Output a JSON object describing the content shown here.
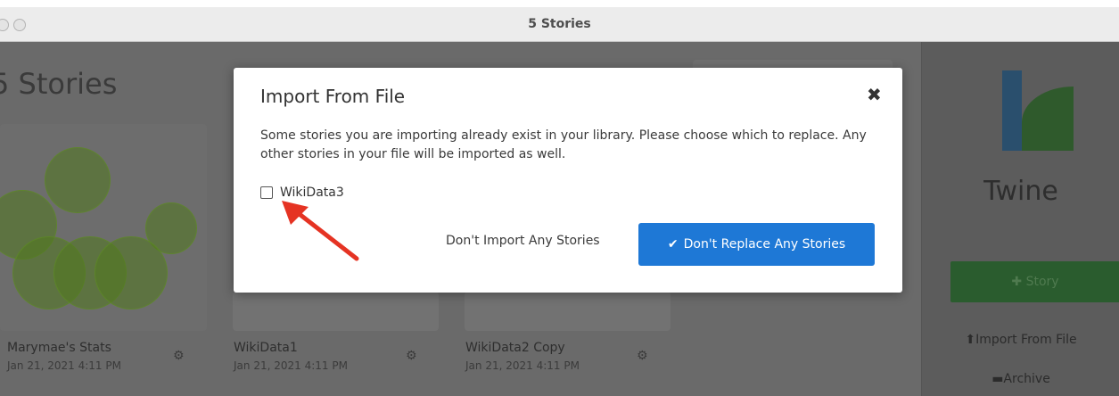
{
  "window": {
    "title": "5 Stories"
  },
  "library": {
    "heading": "5 Stories",
    "cards": [
      {
        "name": "Marymae's Stats",
        "date": "Jan 21, 2021 4:11 PM"
      },
      {
        "name": "WikiData1",
        "date": "Jan 21, 2021 4:11 PM"
      },
      {
        "name": "WikiData2 Copy",
        "date": "Jan 21, 2021 4:11 PM"
      }
    ]
  },
  "sidebar": {
    "logo_text": "Twine",
    "story_button": "Story",
    "import_link": "Import From File",
    "archive_link": "Archive"
  },
  "dialog": {
    "title": "Import From File",
    "close_icon": "close-icon",
    "message": "Some stories you are importing already exist in your library. Please choose which to replace. Any other stories in your file will be imported as well.",
    "story_option": {
      "label": "WikiData3",
      "checked": false
    },
    "secondary_button": "Don't Import Any Stories",
    "primary_button": "Don't Replace Any Stories"
  },
  "colors": {
    "primary": "#1e78d6",
    "arrow": "#e53323",
    "story_green": "#2a5c2e"
  }
}
